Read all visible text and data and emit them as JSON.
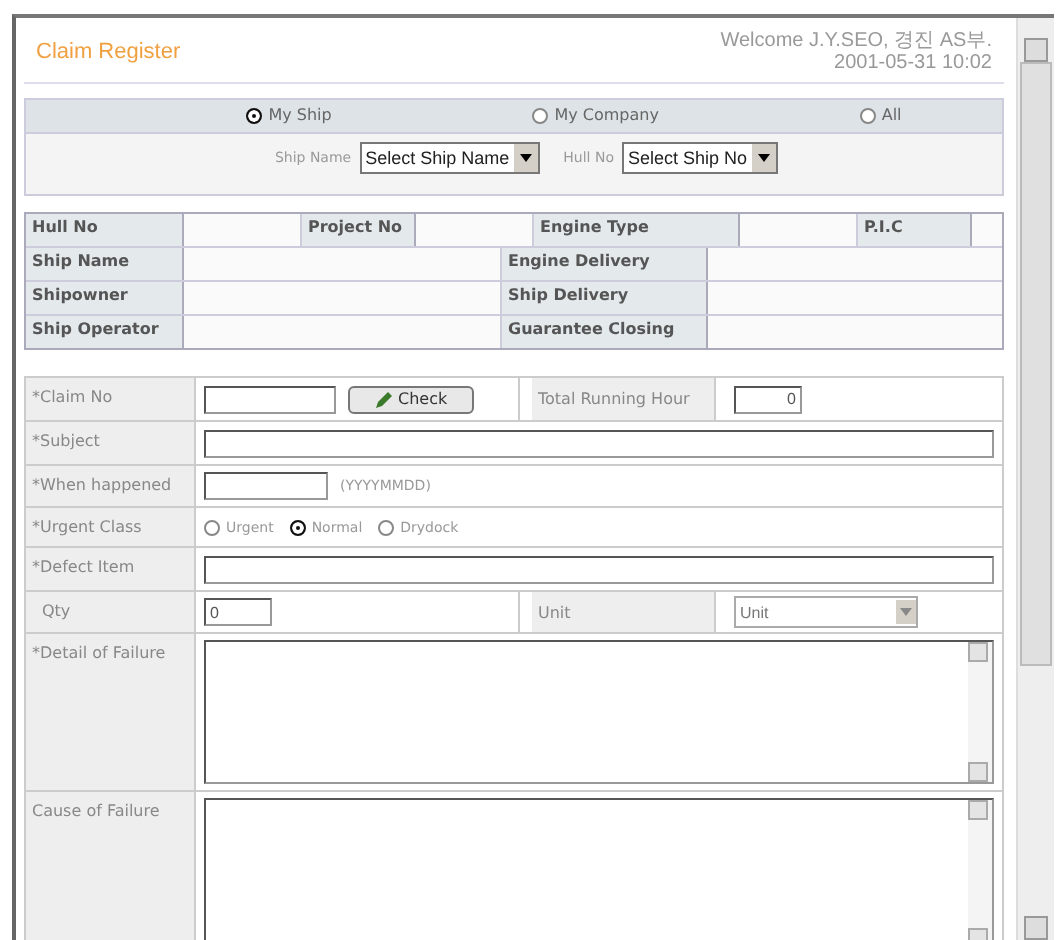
{
  "title": "Claim Register",
  "welcome": "Welcome J.Y.SEO, 경진 AS부.",
  "datetime": "2001-05-31  10:02",
  "scope_options": [
    {
      "label": "My Ship",
      "selected": true
    },
    {
      "label": "My Company",
      "selected": false
    },
    {
      "label": "All",
      "selected": false
    }
  ],
  "ship_name": {
    "label": "Ship Name",
    "value": "Select Ship Name"
  },
  "hull_no": {
    "label": "Hull No",
    "value": "Select Ship No"
  },
  "info_rows": [
    {
      "cells": [
        {
          "text": "Hull No",
          "kind": "head"
        },
        {
          "text": "",
          "kind": "value"
        },
        {
          "text": "Project No",
          "kind": "head"
        },
        {
          "text": "",
          "kind": "value"
        },
        {
          "text": "Engine Type",
          "kind": "head"
        },
        {
          "text": "",
          "kind": "value"
        },
        {
          "text": "P.I.C",
          "kind": "head"
        },
        {
          "text": "",
          "kind": "value"
        }
      ]
    },
    {
      "cells": [
        {
          "text": "Ship Name",
          "kind": "head"
        },
        {
          "text": "",
          "kind": "wide"
        },
        {
          "text": "Engine Delivery",
          "kind": "head"
        },
        {
          "text": "",
          "kind": "wide"
        }
      ]
    },
    {
      "cells": [
        {
          "text": "Shipowner",
          "kind": "head"
        },
        {
          "text": "",
          "kind": "wide"
        },
        {
          "text": "Ship Delivery",
          "kind": "head"
        },
        {
          "text": "",
          "kind": "wide"
        }
      ]
    },
    {
      "cells": [
        {
          "text": "Ship Operator",
          "kind": "head"
        },
        {
          "text": "",
          "kind": "wide"
        },
        {
          "text": "Guarantee Closing",
          "kind": "head"
        },
        {
          "text": "",
          "kind": "wide"
        }
      ]
    }
  ],
  "claim_no": {
    "label": "*Claim No",
    "button": "Check"
  },
  "running_hour": {
    "label": "Total Running Hour",
    "value": "0"
  },
  "subject": {
    "label": "*Subject"
  },
  "when_happened": {
    "label": "*When happened",
    "hint": "(YYYYMMDD)"
  },
  "urgent_class": {
    "label": "*Urgent Class",
    "options": [
      {
        "label": "Urgent",
        "selected": false
      },
      {
        "label": "Normal",
        "selected": true
      },
      {
        "label": "Drydock",
        "selected": false
      }
    ]
  },
  "defect_item": {
    "label": "*Defect Item"
  },
  "qty": {
    "label": "Qty",
    "value": "0"
  },
  "unit": {
    "label": "Unit",
    "value": "Unit"
  },
  "detail": {
    "label": "*Detail of Failure"
  },
  "cause": {
    "label": "Cause of Failure"
  }
}
